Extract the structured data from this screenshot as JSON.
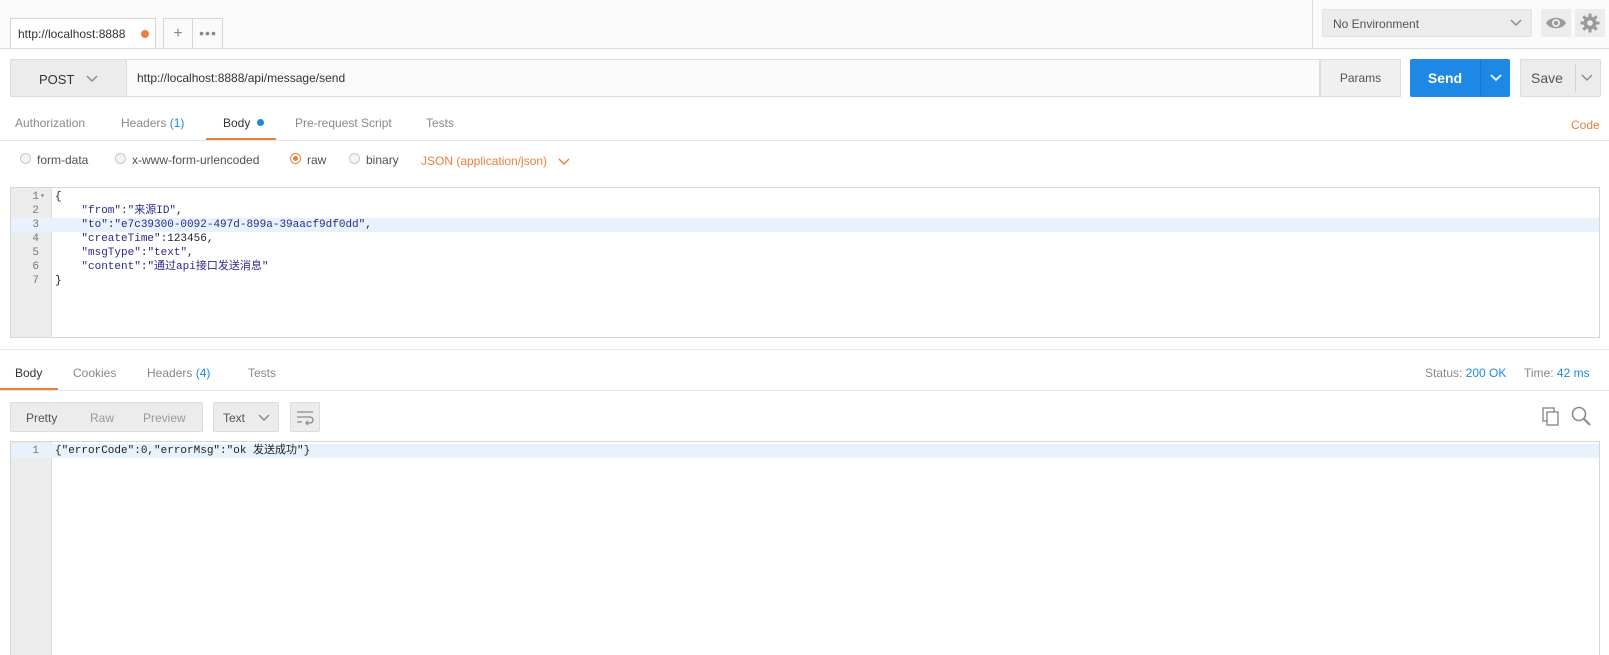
{
  "tab_bar": {
    "active_tab_label": "http://localhost:8888",
    "add_label": "+",
    "more_label": "•••"
  },
  "environment": {
    "selected": "No Environment"
  },
  "request": {
    "method": "POST",
    "url": "http://localhost:8888/api/message/send",
    "params_label": "Params",
    "send_label": "Send",
    "save_label": "Save"
  },
  "request_tabs": {
    "authorization": "Authorization",
    "headers": "Headers",
    "headers_count": "(1)",
    "body": "Body",
    "pre_request": "Pre-request Script",
    "tests": "Tests",
    "code_link": "Code"
  },
  "body_types": {
    "form_data": "form-data",
    "urlencoded": "x-www-form-urlencoded",
    "raw": "raw",
    "binary": "binary",
    "content_type": "JSON (application/json)"
  },
  "request_body": {
    "lines": [
      {
        "num": "1",
        "fold": "▾",
        "parts": [
          {
            "t": "{",
            "c": "p"
          }
        ]
      },
      {
        "num": "2",
        "parts": [
          {
            "t": "    ",
            "c": "p"
          },
          {
            "t": "\"from\"",
            "c": "k"
          },
          {
            "t": ":",
            "c": "p"
          },
          {
            "t": "\"来源ID\"",
            "c": "s"
          },
          {
            "t": ",",
            "c": "p"
          }
        ]
      },
      {
        "num": "3",
        "parts": [
          {
            "t": "    ",
            "c": "p"
          },
          {
            "t": "\"to\"",
            "c": "k"
          },
          {
            "t": ":",
            "c": "p"
          },
          {
            "t": "\"e7c39300-0092-497d-899a-39aacf9df0dd\"",
            "c": "s"
          },
          {
            "t": ",",
            "c": "p"
          }
        ]
      },
      {
        "num": "4",
        "parts": [
          {
            "t": "    ",
            "c": "p"
          },
          {
            "t": "\"createTime\"",
            "c": "k"
          },
          {
            "t": ":",
            "c": "p"
          },
          {
            "t": "123456",
            "c": "n"
          },
          {
            "t": ",",
            "c": "p"
          }
        ]
      },
      {
        "num": "5",
        "parts": [
          {
            "t": "    ",
            "c": "p"
          },
          {
            "t": "\"msgType\"",
            "c": "k"
          },
          {
            "t": ":",
            "c": "p"
          },
          {
            "t": "\"text\"",
            "c": "s"
          },
          {
            "t": ",",
            "c": "p"
          }
        ]
      },
      {
        "num": "6",
        "parts": [
          {
            "t": "    ",
            "c": "p"
          },
          {
            "t": "\"content\"",
            "c": "k"
          },
          {
            "t": ":",
            "c": "p"
          },
          {
            "t": "\"通过api接口发送消息\"",
            "c": "s"
          }
        ]
      },
      {
        "num": "7",
        "parts": [
          {
            "t": "}",
            "c": "p"
          }
        ]
      }
    ],
    "highlight_line": 3
  },
  "response_tabs": {
    "body": "Body",
    "cookies": "Cookies",
    "headers": "Headers",
    "headers_count": "(4)",
    "tests": "Tests"
  },
  "response_status": {
    "status_label": "Status:",
    "status_value": "200 OK",
    "time_label": "Time:",
    "time_value": "42 ms"
  },
  "response_view": {
    "pretty": "Pretty",
    "raw": "Raw",
    "preview": "Preview",
    "format": "Text"
  },
  "response_body": {
    "line_num": "1",
    "text": "{\"errorCode\":0,\"errorMsg\":\"ok 发送成功\"}"
  },
  "colors": {
    "accent_orange": "#e8813f",
    "send_blue": "#1e88e5"
  }
}
